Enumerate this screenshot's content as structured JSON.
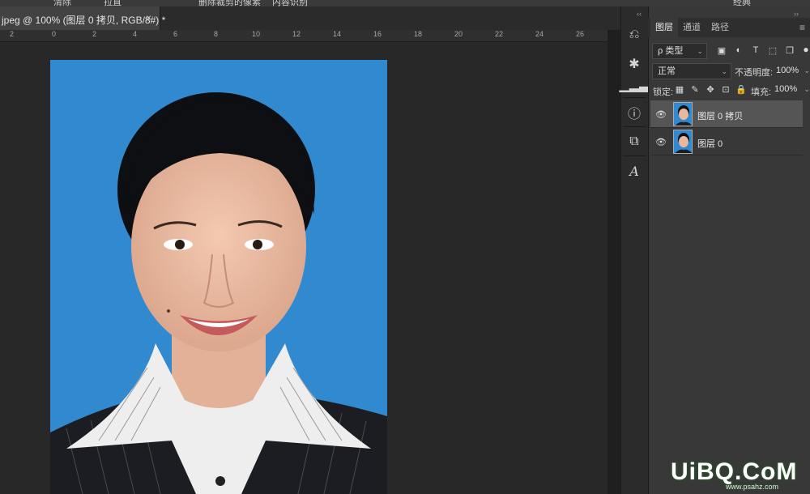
{
  "options_bar": {
    "items": [
      "清除",
      "拉直",
      "删除裁剪的像素",
      "内容识别",
      "经典"
    ]
  },
  "document": {
    "tab_title": "jpeg @ 100% (图层 0 拷贝, RGB/8#) *",
    "close_glyph": "×"
  },
  "ruler": {
    "ticks": [
      "2",
      "0",
      "2",
      "4",
      "6",
      "8",
      "10",
      "12",
      "14",
      "16",
      "18",
      "20",
      "22",
      "24",
      "26"
    ]
  },
  "tool_strip": {
    "collapse_glyph": "‹‹",
    "icons": [
      "history-icon",
      "navigator-icon",
      "histogram-icon",
      "info-icon",
      "properties-icon",
      "character-icon"
    ]
  },
  "layers_panel": {
    "collapse_glyph": "››",
    "tabs": [
      "图层",
      "通道",
      "路径"
    ],
    "menu_glyph": "≡",
    "filter_kind": "ρ 类型",
    "blend_mode": "正常",
    "opacity_label": "不透明度:",
    "opacity_value": "100%",
    "lock_label": "锁定:",
    "fill_label": "填充:",
    "fill_value": "100%",
    "layers": [
      {
        "name": "图层 0 拷贝",
        "selected": true
      },
      {
        "name": "图层 0",
        "selected": false
      }
    ]
  },
  "watermark": {
    "text": "UiBQ.CoM",
    "sub": "www.psahz.com"
  },
  "colors": {
    "photo_background": "#3189d0",
    "app_background": "#282828",
    "panel_background": "#383838"
  }
}
